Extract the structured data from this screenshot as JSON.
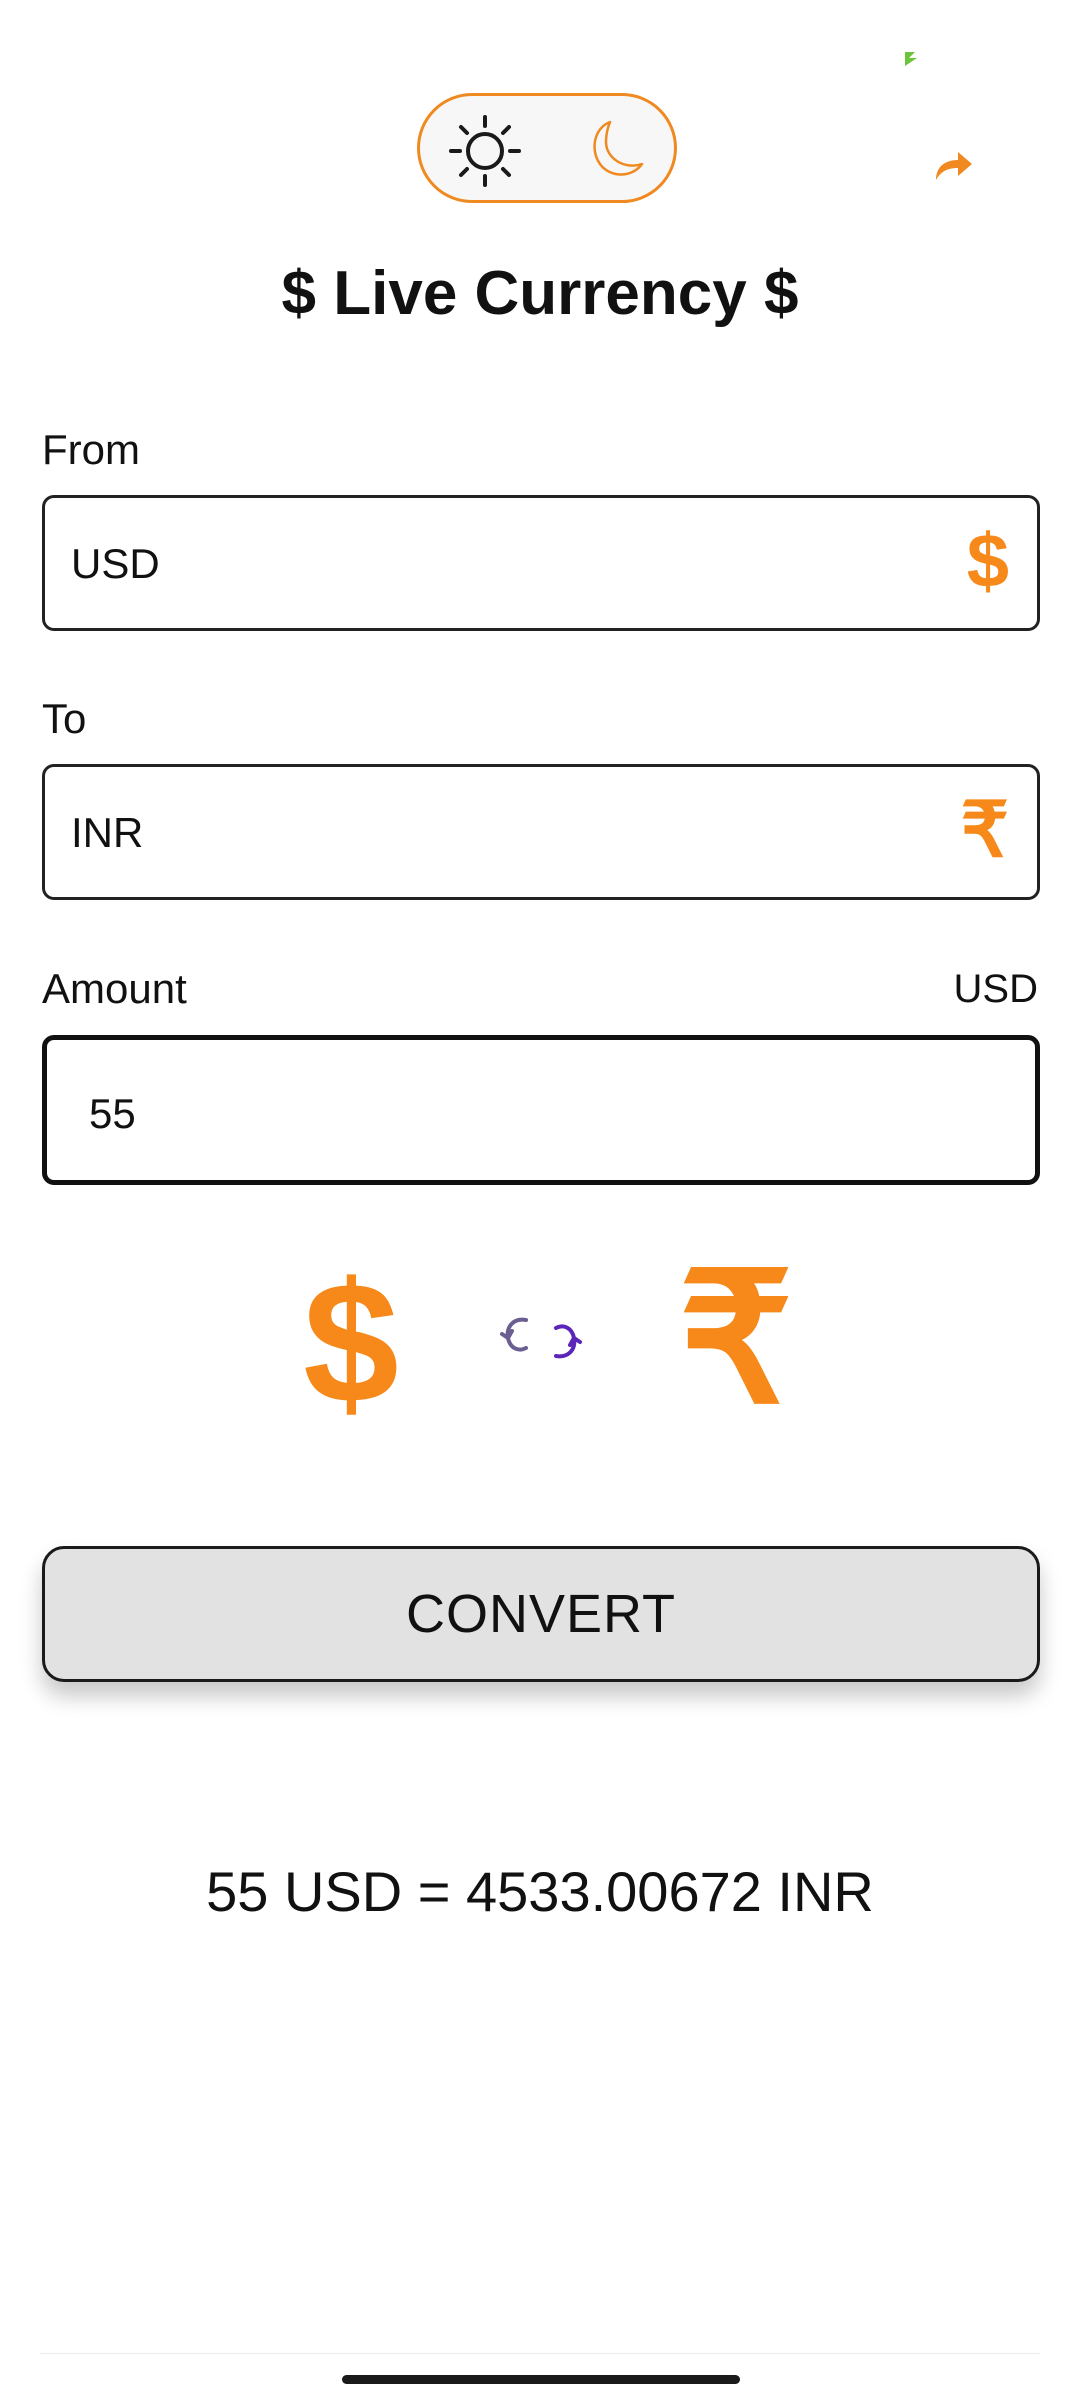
{
  "colors": {
    "accent": "#f7891b",
    "toggle_border": "#f0891f",
    "button_bg": "#e2e2e2",
    "swap_left": "#6b5f91",
    "swap_right": "#5a25b8",
    "status_green": "#6bc43a"
  },
  "theme_toggle": {
    "light_icon": "sun-icon",
    "dark_icon": "moon-icon"
  },
  "header": {
    "title": "$ Live Currency $",
    "share_icon": "share-arrow-icon"
  },
  "from": {
    "label": "From",
    "value": "USD",
    "icon": "$"
  },
  "to": {
    "label": "To",
    "value": "INR",
    "icon": "₹"
  },
  "amount": {
    "label": "Amount",
    "currency": "USD",
    "value": "55"
  },
  "symbols": {
    "from_symbol": "$",
    "to_symbol": "₹",
    "swap_icon": "swap-arrows-icon"
  },
  "convert_button": {
    "label": "CONVERT"
  },
  "result": {
    "text": "55 USD = 4533.00672 INR"
  }
}
